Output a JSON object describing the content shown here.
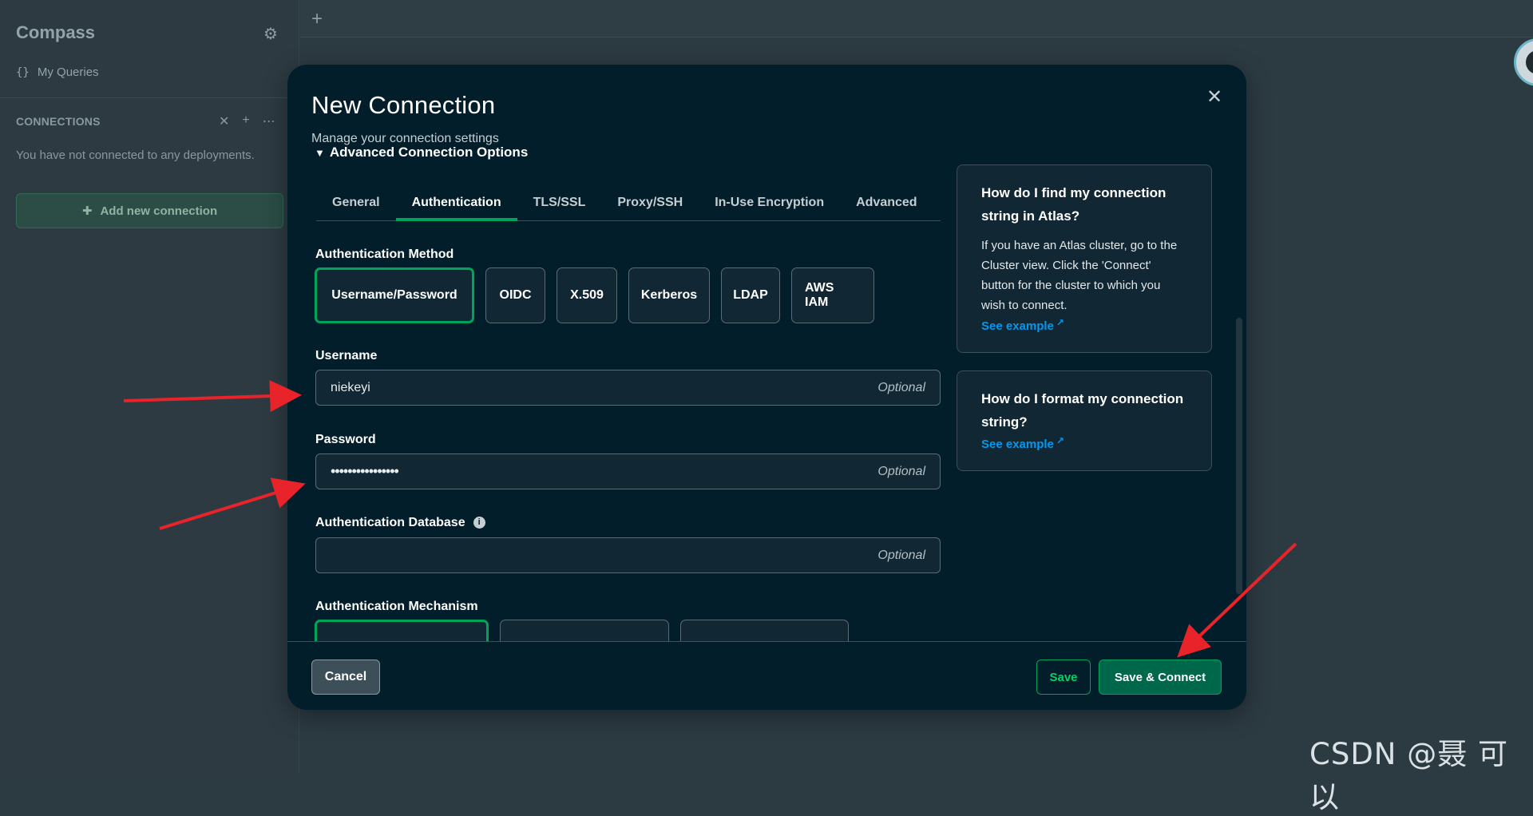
{
  "sidebar": {
    "app_title": "Compass",
    "settings_icon": "gear-icon",
    "my_queries": "My Queries",
    "my_queries_icon": "{}",
    "connections_heading": "CONNECTIONS",
    "empty_message": "You have not connected to any deployments.",
    "add_connection": "Add new connection"
  },
  "main": {
    "new_tab_icon": "+"
  },
  "modal": {
    "title": "New Connection",
    "subtitle": "Manage your connection settings",
    "advanced_toggle": "Advanced Connection Options",
    "tabs": [
      {
        "label": "General"
      },
      {
        "label": "Authentication",
        "active": true
      },
      {
        "label": "TLS/SSL"
      },
      {
        "label": "Proxy/SSH"
      },
      {
        "label": "In-Use Encryption"
      },
      {
        "label": "Advanced"
      }
    ],
    "auth_method_label": "Authentication Method",
    "auth_methods": [
      {
        "label": "Username/Password",
        "selected": true
      },
      {
        "label": "OIDC"
      },
      {
        "label": "X.509"
      },
      {
        "label": "Kerberos"
      },
      {
        "label": "LDAP"
      },
      {
        "label": "AWS IAM"
      }
    ],
    "username_label": "Username",
    "username_value": "niekeyi",
    "password_label": "Password",
    "password_value": "••••••••••••••••",
    "auth_db_label": "Authentication Database",
    "auth_db_value": "",
    "optional_hint": "Optional",
    "auth_mechanism_label": "Authentication Mechanism",
    "help_cards": [
      {
        "title": "How do I find my connection string in Atlas?",
        "body": "If you have an Atlas cluster, go to the Cluster view. Click the 'Connect' button for the cluster to which you wish to connect.",
        "link": "See example"
      },
      {
        "title": "How do I format my connection string?",
        "link": "See example"
      }
    ],
    "buttons": {
      "cancel": "Cancel",
      "save": "Save",
      "save_connect": "Save & Connect"
    }
  },
  "watermark": "CSDN @聂 可 以",
  "colors": {
    "accent": "#00a35c",
    "primary_button": "#00684a",
    "link": "#0498ec",
    "modal_bg": "#021e2a",
    "annotation_arrow": "#e8232a"
  }
}
